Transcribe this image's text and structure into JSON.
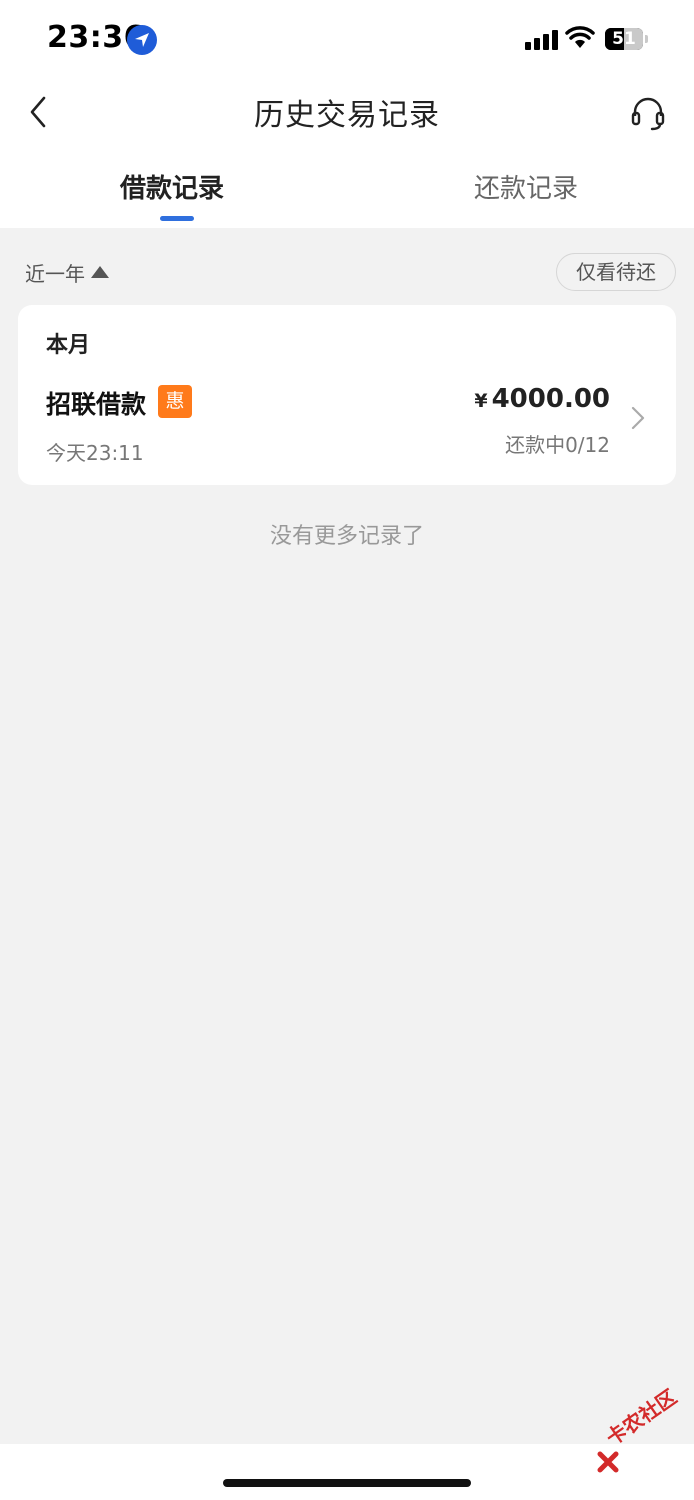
{
  "status_bar": {
    "time": "23:36",
    "battery": "51"
  },
  "nav": {
    "title": "历史交易记录"
  },
  "tabs": [
    {
      "label": "借款记录",
      "active": true
    },
    {
      "label": "还款记录",
      "active": false
    }
  ],
  "filter": {
    "period": "近一年",
    "pending_only_label": "仅看待还"
  },
  "group": {
    "title": "本月",
    "items": [
      {
        "name": "招联借款",
        "badge": "惠",
        "time": "今天23:11",
        "currency": "¥",
        "amount": "4000.00",
        "status": "还款中0/12"
      }
    ]
  },
  "footer_text": "没有更多记录了",
  "watermark": "卡农社区",
  "colors": {
    "accent": "#2f6fde",
    "badge": "#ff7a1a",
    "location": "#1f5cd8"
  }
}
